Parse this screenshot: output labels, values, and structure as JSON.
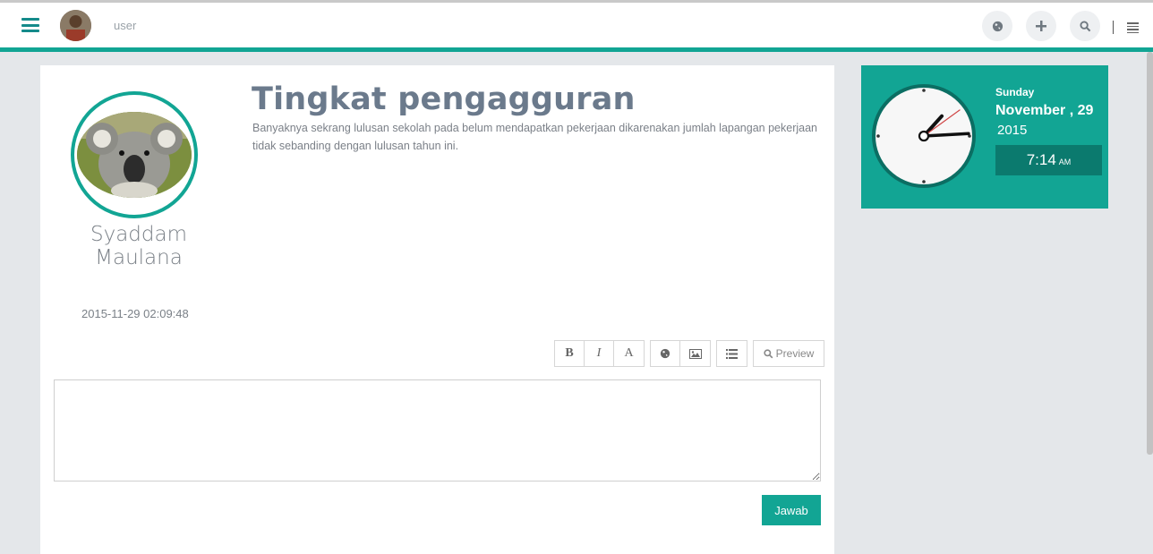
{
  "topbar": {
    "user_label": "user",
    "icons": [
      "menu-icon",
      "globe-icon",
      "plus-icon",
      "search-icon",
      "list-icon"
    ]
  },
  "post": {
    "author": "Syaddam Maulana",
    "timestamp": "2015-11-29 02:09:48",
    "title": "Tingkat pengagguran",
    "body": "Banyaknya sekrang lulusan sekolah pada belum mendapatkan pekerjaan dikarenakan jumlah lapangan pekerjaan tidak sebanding dengan lulusan tahun ini."
  },
  "editor": {
    "bold": "B",
    "italic": "I",
    "heading": "A",
    "preview": "Preview",
    "submit": "Jawab"
  },
  "clock": {
    "day": "Sunday",
    "date": "November , 29",
    "year": "2015",
    "time": "7:14",
    "ampm": "AM",
    "hours": 7,
    "minutes": 14,
    "seconds": 9
  },
  "colors": {
    "accent": "#12a594",
    "accent_dark": "#0b7a6e",
    "title": "#6b7a8c"
  }
}
